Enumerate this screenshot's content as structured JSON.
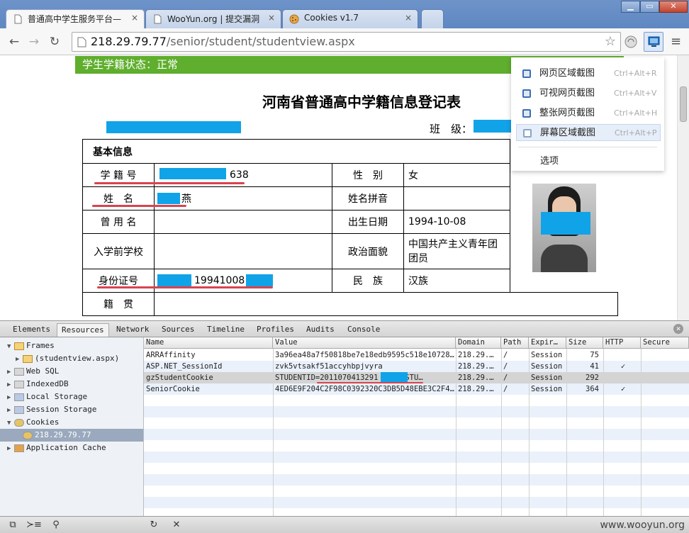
{
  "browser": {
    "tabs": [
      {
        "title": "普通高中学生服务平台—",
        "active": true
      },
      {
        "title": "WooYun.org | 提交漏洞",
        "active": false
      },
      {
        "title": "Cookies v1.7",
        "active": false
      }
    ],
    "close_glyph": "×",
    "window_buttons": {
      "minimize": "▁",
      "maximize": "▭",
      "close": "✕"
    },
    "nav": {
      "back": "←",
      "forward": "→",
      "reload": "↻"
    },
    "url_host": "218.29.79.77",
    "url_path": "/senior/student/studentview.aspx",
    "star": "☆",
    "menu": "≡"
  },
  "page": {
    "status_bar": "学生学籍状态：正常",
    "doc_title": "河南省普通高中学籍信息登记表",
    "class_label": "班　级：",
    "section_title": "基本信息",
    "rows": [
      {
        "label": "学 籍 号",
        "value": "638",
        "label2": "性　别",
        "value2": "女"
      },
      {
        "label": "姓　名",
        "value": "燕",
        "label2": "姓名拼音",
        "value2": ""
      },
      {
        "label": "曾 用 名",
        "value": "",
        "label2": "出生日期",
        "value2": "1994-10-08"
      },
      {
        "label": "入学前学校",
        "value": "",
        "label2": "政治面貌",
        "value2": "中国共产主义青年团团员"
      },
      {
        "label": "身份证号",
        "value": "19941008",
        "label2": "民　族",
        "value2": "汉族"
      },
      {
        "label": "籍　贯",
        "value": "",
        "label2": "",
        "value2": ""
      }
    ]
  },
  "capture_menu": {
    "items": [
      {
        "label": "网页区域截图",
        "shortcut": "Ctrl+Alt+R"
      },
      {
        "label": "可视网页截图",
        "shortcut": "Ctrl+Alt+V"
      },
      {
        "label": "整张网页截图",
        "shortcut": "Ctrl+Alt+H"
      },
      {
        "label": "屏幕区域截图",
        "shortcut": "Ctrl+Alt+P"
      }
    ],
    "options": "选项"
  },
  "devtools": {
    "tabs": [
      "Elements",
      "Resources",
      "Network",
      "Sources",
      "Timeline",
      "Profiles",
      "Audits",
      "Console"
    ],
    "active_tab": "Resources",
    "close_glyph": "×",
    "tree": [
      {
        "label": "Frames",
        "level": 0,
        "expanded": true
      },
      {
        "label": "(studentview.aspx)",
        "level": 1,
        "expanded": false
      },
      {
        "label": "Web SQL",
        "level": 0,
        "expanded": false
      },
      {
        "label": "IndexedDB",
        "level": 0,
        "expanded": false
      },
      {
        "label": "Local Storage",
        "level": 0,
        "expanded": false
      },
      {
        "label": "Session Storage",
        "level": 0,
        "expanded": false
      },
      {
        "label": "Cookies",
        "level": 0,
        "expanded": true
      },
      {
        "label": "218.29.79.77",
        "level": 1,
        "selected": true
      },
      {
        "label": "Application Cache",
        "level": 0,
        "expanded": false
      }
    ],
    "columns": [
      "Name",
      "Value",
      "Domain",
      "Path",
      "Expir…",
      "Size",
      "HTTP",
      "Secure"
    ],
    "cookies": [
      {
        "name": "ARRAffinity",
        "value": "3a96ea48a7f50818be7e18edb9595c518e10728…",
        "domain": "218.29.…",
        "path": "/",
        "expires": "Session",
        "size": "75",
        "http": ""
      },
      {
        "name": "ASP.NET_SessionId",
        "value": "zvk5vtsakf51accyhbpjvyra",
        "domain": "218.29.…",
        "path": "/",
        "expires": "Session",
        "size": "41",
        "http": "✓"
      },
      {
        "name": "gzStudentCookie",
        "value": "STUDENTID=2011070413291 6600&STU…",
        "domain": "218.29.…",
        "path": "/",
        "expires": "Session",
        "size": "292",
        "http": ""
      },
      {
        "name": "SeniorCookie",
        "value": "4ED6E9F204C2F98C0392320C3DB5D48EBE3C2F4…",
        "domain": "218.29.…",
        "path": "/",
        "expires": "Session",
        "size": "364",
        "http": "✓"
      }
    ],
    "bottom_icons": {
      "dock": "⧉",
      "console": "≻≡",
      "search": "⚲",
      "refresh": "↻",
      "clear": "✕"
    },
    "watermark": "www.wooyun.org"
  }
}
